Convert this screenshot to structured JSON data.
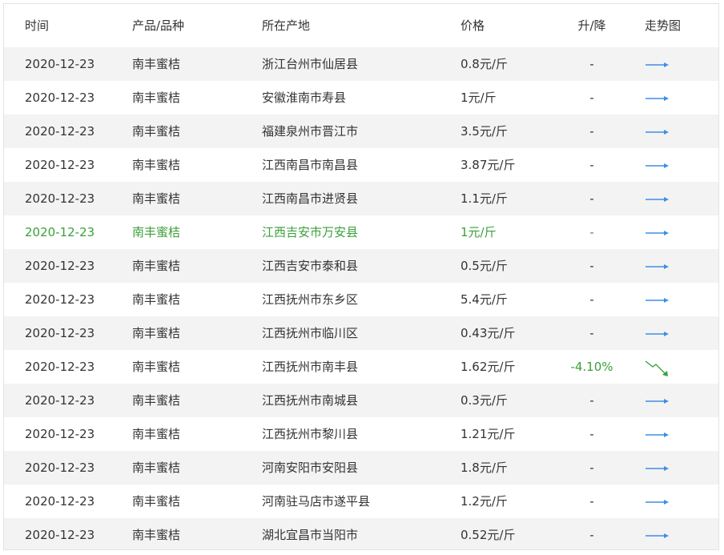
{
  "headers": {
    "date": "时间",
    "product": "产品/品种",
    "location": "所在产地",
    "price": "价格",
    "change": "升/降",
    "trend": "走势图"
  },
  "colors": {
    "trend_flat": "#3f8ee8",
    "trend_down": "#3aa03a",
    "highlight_text": "#3aa03a"
  },
  "rows": [
    {
      "date": "2020-12-23",
      "product": "南丰蜜桔",
      "location": "浙江台州市仙居县",
      "price": "0.8元/斤",
      "change": "-",
      "trend_icon": "flat-arrow-icon"
    },
    {
      "date": "2020-12-23",
      "product": "南丰蜜桔",
      "location": "安徽淮南市寿县",
      "price": "1元/斤",
      "change": "-",
      "trend_icon": "flat-arrow-icon"
    },
    {
      "date": "2020-12-23",
      "product": "南丰蜜桔",
      "location": "福建泉州市晋江市",
      "price": "3.5元/斤",
      "change": "-",
      "trend_icon": "flat-arrow-icon"
    },
    {
      "date": "2020-12-23",
      "product": "南丰蜜桔",
      "location": "江西南昌市南昌县",
      "price": "3.87元/斤",
      "change": "-",
      "trend_icon": "flat-arrow-icon"
    },
    {
      "date": "2020-12-23",
      "product": "南丰蜜桔",
      "location": "江西南昌市进贤县",
      "price": "1.1元/斤",
      "change": "-",
      "trend_icon": "flat-arrow-icon"
    },
    {
      "date": "2020-12-23",
      "product": "南丰蜜桔",
      "location": "江西吉安市万安县",
      "price": "1元/斤",
      "change": "-",
      "trend_icon": "flat-arrow-icon",
      "highlight": true
    },
    {
      "date": "2020-12-23",
      "product": "南丰蜜桔",
      "location": "江西吉安市泰和县",
      "price": "0.5元/斤",
      "change": "-",
      "trend_icon": "flat-arrow-icon"
    },
    {
      "date": "2020-12-23",
      "product": "南丰蜜桔",
      "location": "江西抚州市东乡区",
      "price": "5.4元/斤",
      "change": "-",
      "trend_icon": "flat-arrow-icon"
    },
    {
      "date": "2020-12-23",
      "product": "南丰蜜桔",
      "location": "江西抚州市临川区",
      "price": "0.43元/斤",
      "change": "-",
      "trend_icon": "flat-arrow-icon"
    },
    {
      "date": "2020-12-23",
      "product": "南丰蜜桔",
      "location": "江西抚州市南丰县",
      "price": "1.62元/斤",
      "change": "-4.10%",
      "trend_icon": "down-arrow-icon"
    },
    {
      "date": "2020-12-23",
      "product": "南丰蜜桔",
      "location": "江西抚州市南城县",
      "price": "0.3元/斤",
      "change": "-",
      "trend_icon": "flat-arrow-icon"
    },
    {
      "date": "2020-12-23",
      "product": "南丰蜜桔",
      "location": "江西抚州市黎川县",
      "price": "1.21元/斤",
      "change": "-",
      "trend_icon": "flat-arrow-icon"
    },
    {
      "date": "2020-12-23",
      "product": "南丰蜜桔",
      "location": "河南安阳市安阳县",
      "price": "1.8元/斤",
      "change": "-",
      "trend_icon": "flat-arrow-icon"
    },
    {
      "date": "2020-12-23",
      "product": "南丰蜜桔",
      "location": "河南驻马店市遂平县",
      "price": "1.2元/斤",
      "change": "-",
      "trend_icon": "flat-arrow-icon"
    },
    {
      "date": "2020-12-23",
      "product": "南丰蜜桔",
      "location": "湖北宜昌市当阳市",
      "price": "0.52元/斤",
      "change": "-",
      "trend_icon": "flat-arrow-icon"
    }
  ]
}
